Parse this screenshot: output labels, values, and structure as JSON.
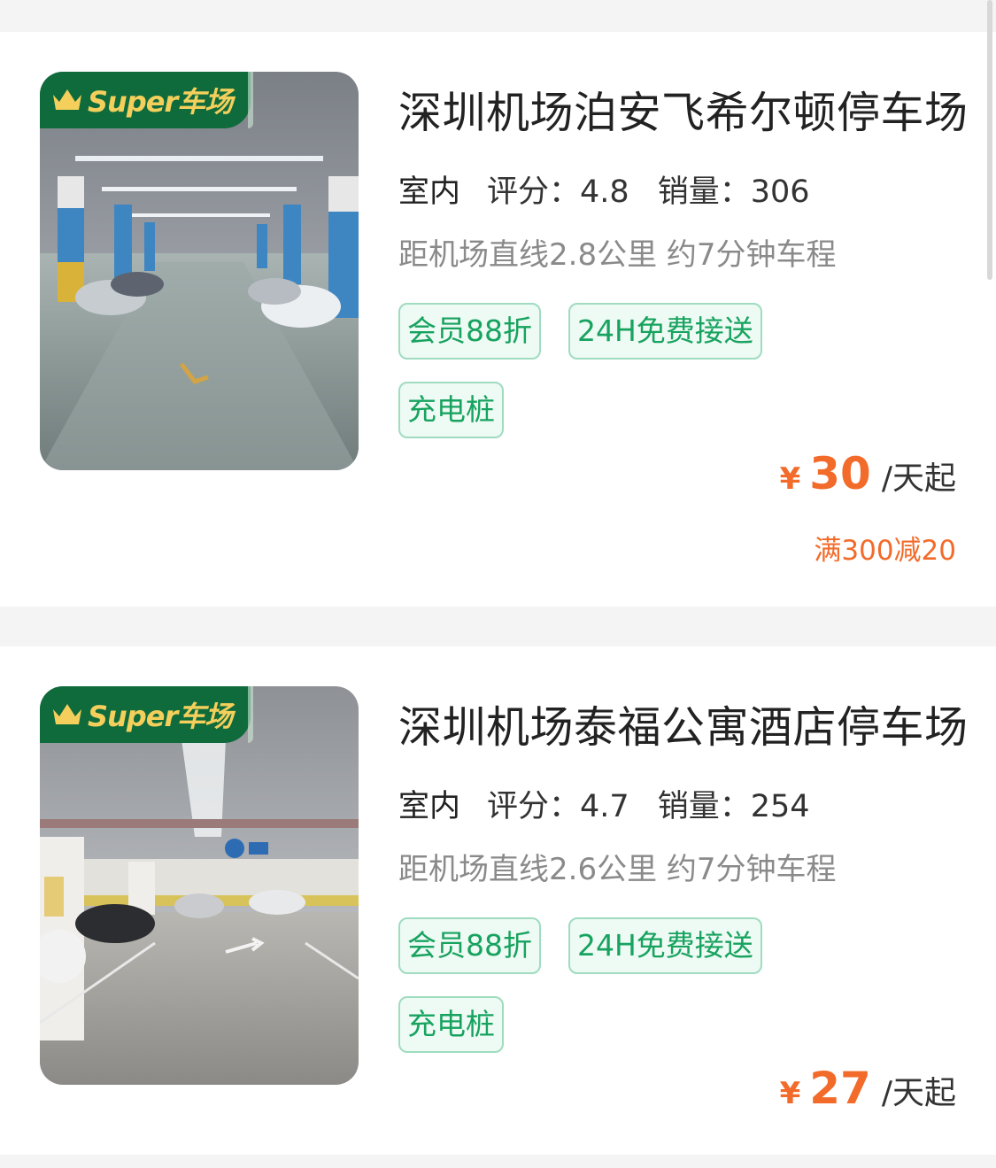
{
  "lots": [
    {
      "badge": "Super车场",
      "name": "深圳机场泊安飞希尔顿停车场",
      "type": "室内",
      "rating": "评分：4.8",
      "sales": "销量：306",
      "distance": "距机场直线2.8公里 约7分钟车程",
      "tags": [
        "会员88折",
        "24H免费接送",
        "充电桩"
      ],
      "price_symbol": "¥",
      "price": "30",
      "price_unit": "/天起",
      "promo": "满300减20"
    },
    {
      "badge": "Super车场",
      "name": "深圳机场泰福公寓酒店停车场",
      "type": "室内",
      "rating": "评分：4.7",
      "sales": "销量：254",
      "distance": "距机场直线2.6公里 约7分钟车程",
      "tags": [
        "会员88折",
        "24H免费接送",
        "充电桩"
      ],
      "price_symbol": "¥",
      "price": "27",
      "price_unit": "/天起"
    }
  ],
  "colors": {
    "accent_green": "#17a35f",
    "badge_green": "#0f6b3c",
    "price_orange": "#f26b2a"
  }
}
